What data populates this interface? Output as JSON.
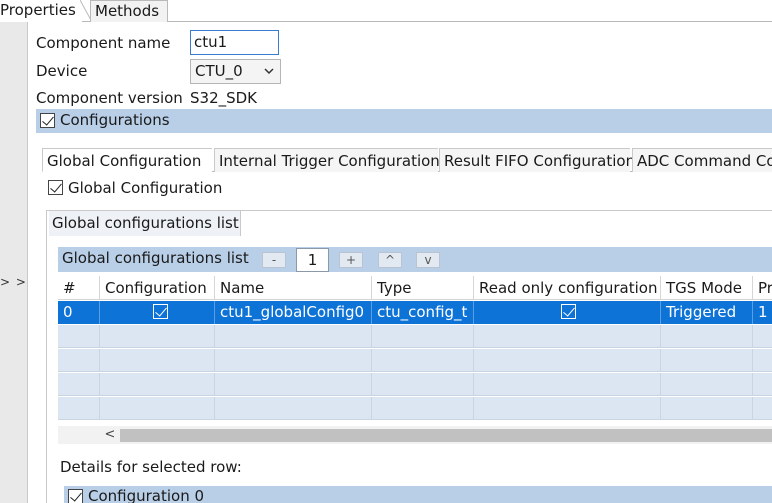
{
  "top_tabs": {
    "properties": "Properties",
    "methods": "Methods"
  },
  "gutter": {
    "expand_label": "> >"
  },
  "form": {
    "component_name_label": "Component name",
    "component_name_value": "ctu1",
    "device_label": "Device",
    "device_value": "CTU_0",
    "component_version_label": "Component version",
    "component_version_value": "S32_SDK",
    "configurations_label": "Configurations"
  },
  "inner_tabs": [
    "Global Configuration",
    "Internal Trigger Configuration",
    "Result FIFO Configuration",
    "ADC Command Co"
  ],
  "global_configuration_check": "Global Configuration",
  "group": {
    "tab_label": "Global configurations list",
    "header_title": "Global configurations list",
    "minus_label": "-",
    "count_value": "1",
    "plus_label": "+",
    "up_label": "^",
    "down_label": "v"
  },
  "table": {
    "columns": [
      "#",
      "Configuration",
      "Name",
      "Type",
      "Read only configuration",
      "TGS Mode",
      "Pr"
    ],
    "rows": [
      {
        "index": "0",
        "configuration": true,
        "name": "ctu1_globalConfig0",
        "type": "ctu_config_t",
        "read_only": true,
        "tgs_mode": "Triggered",
        "pr": "1"
      }
    ]
  },
  "scrollbar": {
    "left_arrow": "<"
  },
  "details": {
    "label": "Details for selected row:",
    "config_label": "Configuration 0"
  }
}
